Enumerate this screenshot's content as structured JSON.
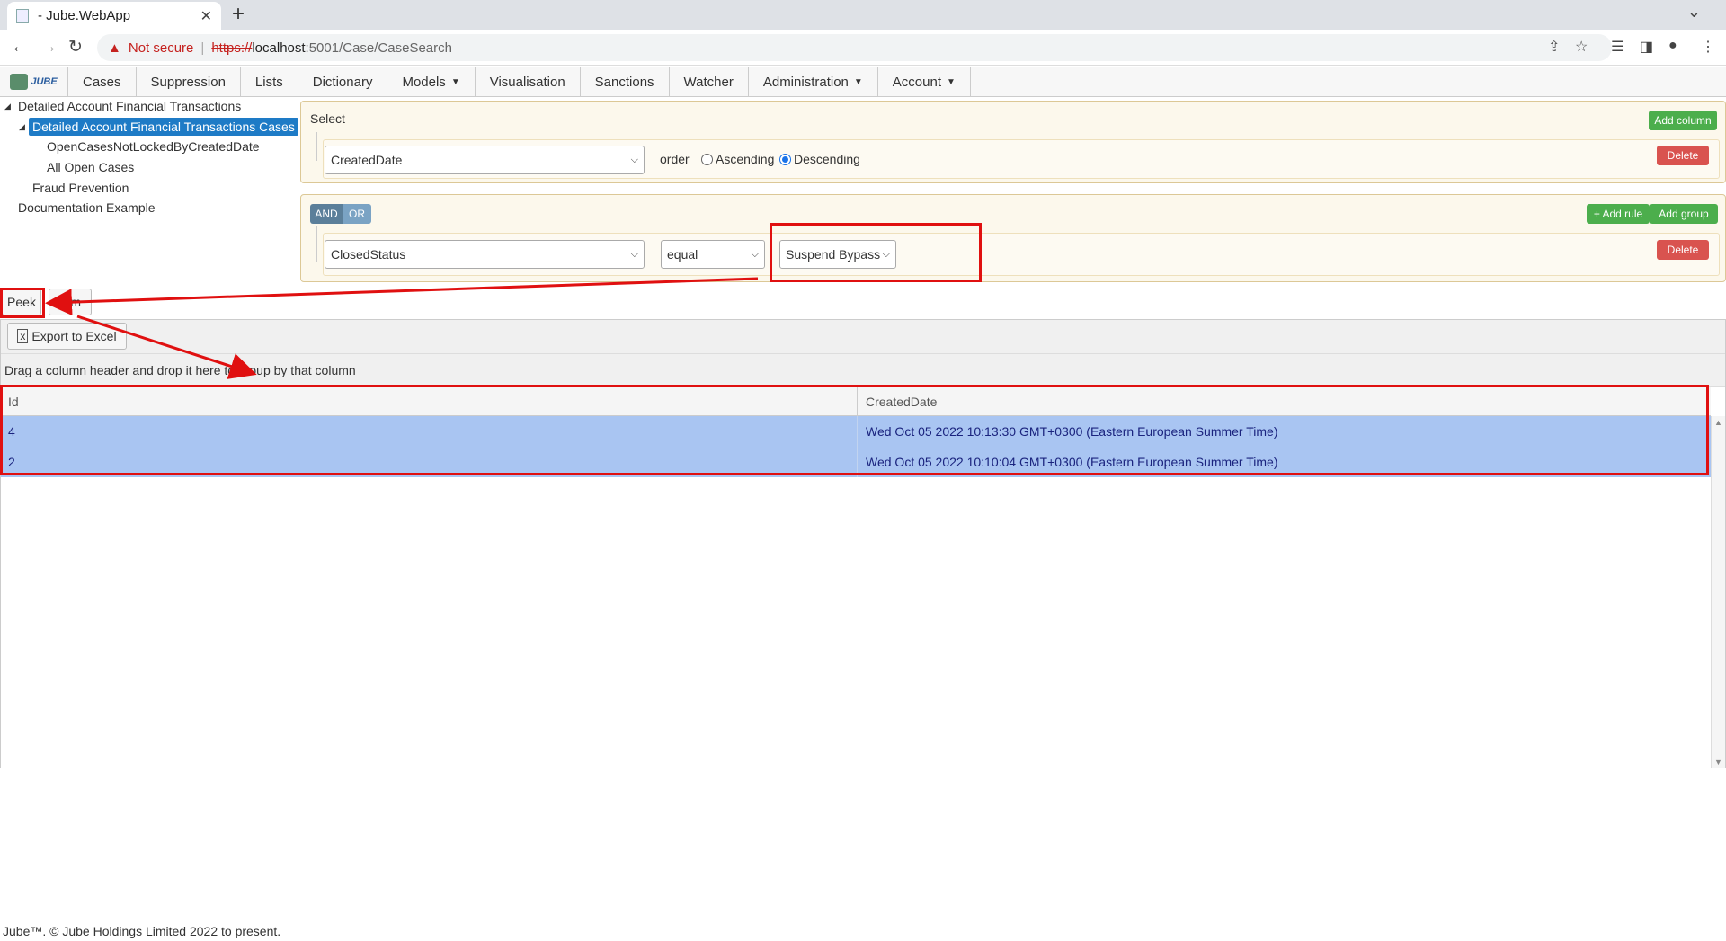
{
  "browser": {
    "tab_title": "- Jube.WebApp",
    "new_tab": "+",
    "not_secure": "Not secure",
    "url_scheme": "https://",
    "url_host": "localhost",
    "url_path": ":5001/Case/CaseSearch"
  },
  "nav": {
    "logo_text": "JUBE",
    "items": [
      "Cases",
      "Suppression",
      "Lists",
      "Dictionary",
      "Models",
      "Visualisation",
      "Sanctions",
      "Watcher",
      "Administration",
      "Account"
    ],
    "dropdown_caret": "▼"
  },
  "tree": {
    "root": "Detailed Account Financial Transactions",
    "selected": "Detailed Account Financial Transactions Cases",
    "child1": "OpenCasesNotLockedByCreatedDate",
    "child2": "All Open Cases",
    "fraud": "Fraud Prevention",
    "doc": "Documentation Example"
  },
  "select_panel": {
    "title": "Select",
    "add_column": "Add column",
    "column_value": "CreatedDate",
    "order_label": "order",
    "ascending": "Ascending",
    "descending": "Descending",
    "order_selected": "Descending",
    "delete": "Delete"
  },
  "filter_panel": {
    "and": "AND",
    "or": "OR",
    "add_rule": "+ Add rule",
    "add_group": "Add group",
    "field": "ClosedStatus",
    "operator": "equal",
    "value": "Suspend Bypass",
    "delete": "Delete"
  },
  "actions": {
    "peek": "Peek",
    "second_button": "Sim",
    "export": "Export to Excel"
  },
  "grid": {
    "group_hint": "Drag a column header and drop it here to group by that column",
    "columns": [
      "Id",
      "CreatedDate"
    ],
    "rows": [
      {
        "id": "4",
        "created": "Wed Oct 05 2022 10:13:30 GMT+0300 (Eastern European Summer Time)"
      },
      {
        "id": "2",
        "created": "Wed Oct 05 2022 10:10:04 GMT+0300 (Eastern European Summer Time)"
      }
    ]
  },
  "footer": "Jube™. © Jube Holdings Limited 2022 to present.",
  "colors": {
    "selected_node": "#1e7bc6",
    "row_highlight": "#a9c5f2",
    "annotation": "#e01010",
    "green": "#4cae4c",
    "red": "#d9534f"
  }
}
